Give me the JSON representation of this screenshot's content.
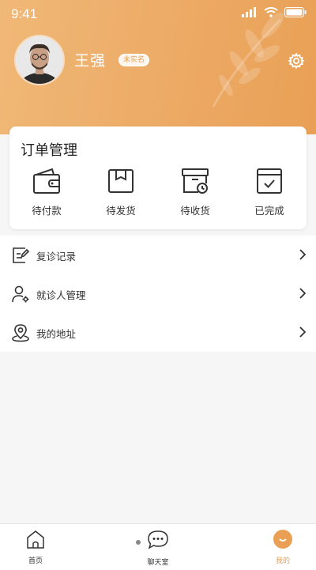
{
  "status_bar": {
    "time": "9:41"
  },
  "profile": {
    "name": "王强",
    "badge": "未实名"
  },
  "orders": {
    "title": "订单管理",
    "items": [
      {
        "label": "待付款",
        "icon": "wallet-icon"
      },
      {
        "label": "待发货",
        "icon": "package-icon"
      },
      {
        "label": "待收货",
        "icon": "delivery-box-clock-icon"
      },
      {
        "label": "已完成",
        "icon": "completed-box-icon"
      }
    ]
  },
  "menu": [
    {
      "label": "复诊记录",
      "icon": "record-edit-icon"
    },
    {
      "label": "就诊人管理",
      "icon": "user-settings-icon"
    },
    {
      "label": "我的地址",
      "icon": "location-pin-icon"
    }
  ],
  "tabbar": [
    {
      "label": "首页",
      "icon": "home-icon",
      "active": false
    },
    {
      "label": "聊天室",
      "icon": "chat-icon",
      "active": false
    },
    {
      "label": "我的",
      "icon": "smile-icon",
      "active": true
    }
  ],
  "colors": {
    "accent": "#e9a055",
    "header_light": "#f0b877"
  }
}
